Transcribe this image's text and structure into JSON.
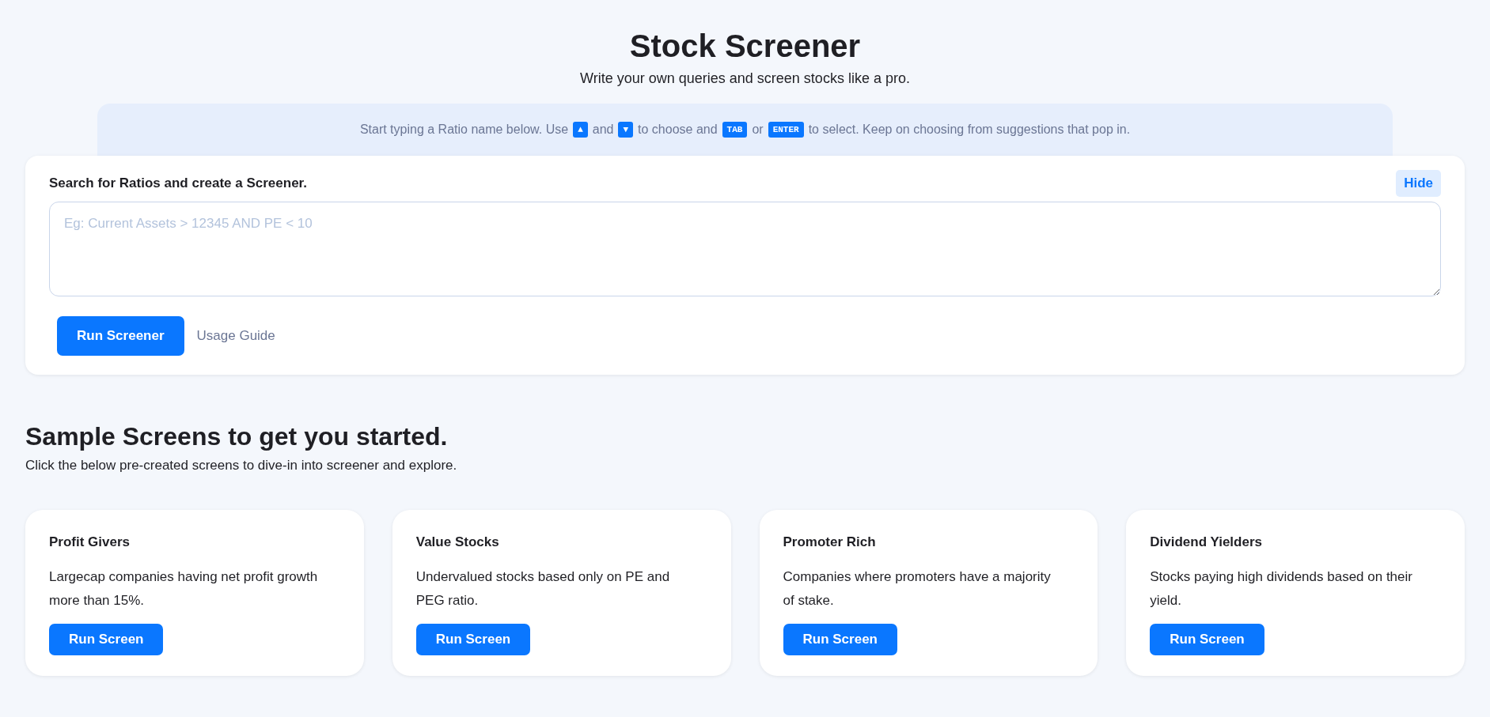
{
  "header": {
    "title": "Stock Screener",
    "subtitle": "Write your own queries and screen stocks like a pro."
  },
  "hint": [
    {
      "kind": "text",
      "text": "Start typing a Ratio name below. Use"
    },
    {
      "kind": "key",
      "text": "▲"
    },
    {
      "kind": "text",
      "text": "and"
    },
    {
      "kind": "key",
      "text": "▼"
    },
    {
      "kind": "text",
      "text": "to choose and"
    },
    {
      "kind": "key",
      "text": "TAB"
    },
    {
      "kind": "text",
      "text": "or"
    },
    {
      "kind": "key",
      "text": "ENTER"
    },
    {
      "kind": "text",
      "text": "to select. Keep on choosing from suggestions that pop in."
    }
  ],
  "query_card": {
    "label": "Search for Ratios and create a Screener.",
    "hide_button": "Hide",
    "query": {
      "placeholder": "Eg: Current Assets > 12345 AND PE < 10"
    },
    "run_button": "Run Screener",
    "guide_link": "Usage Guide"
  },
  "samples": {
    "title": "Sample Screens to get you started.",
    "subtitle": "Click the below pre-created screens to dive-in into screener and explore.",
    "cards": [
      {
        "title": "Profit Givers",
        "description": "Largecap companies having net profit growth more than 15%.",
        "button": "Run Screen"
      },
      {
        "title": "Value Stocks",
        "description": "Undervalued stocks based only on PE and PEG ratio.",
        "button": "Run Screen"
      },
      {
        "title": "Promoter Rich",
        "description": "Companies where promoters have a majority of stake.",
        "button": "Run Screen"
      },
      {
        "title": "Dividend Yielders",
        "description": "Stocks paying high dividends based on their yield.",
        "button": "Run Screen"
      }
    ]
  }
}
